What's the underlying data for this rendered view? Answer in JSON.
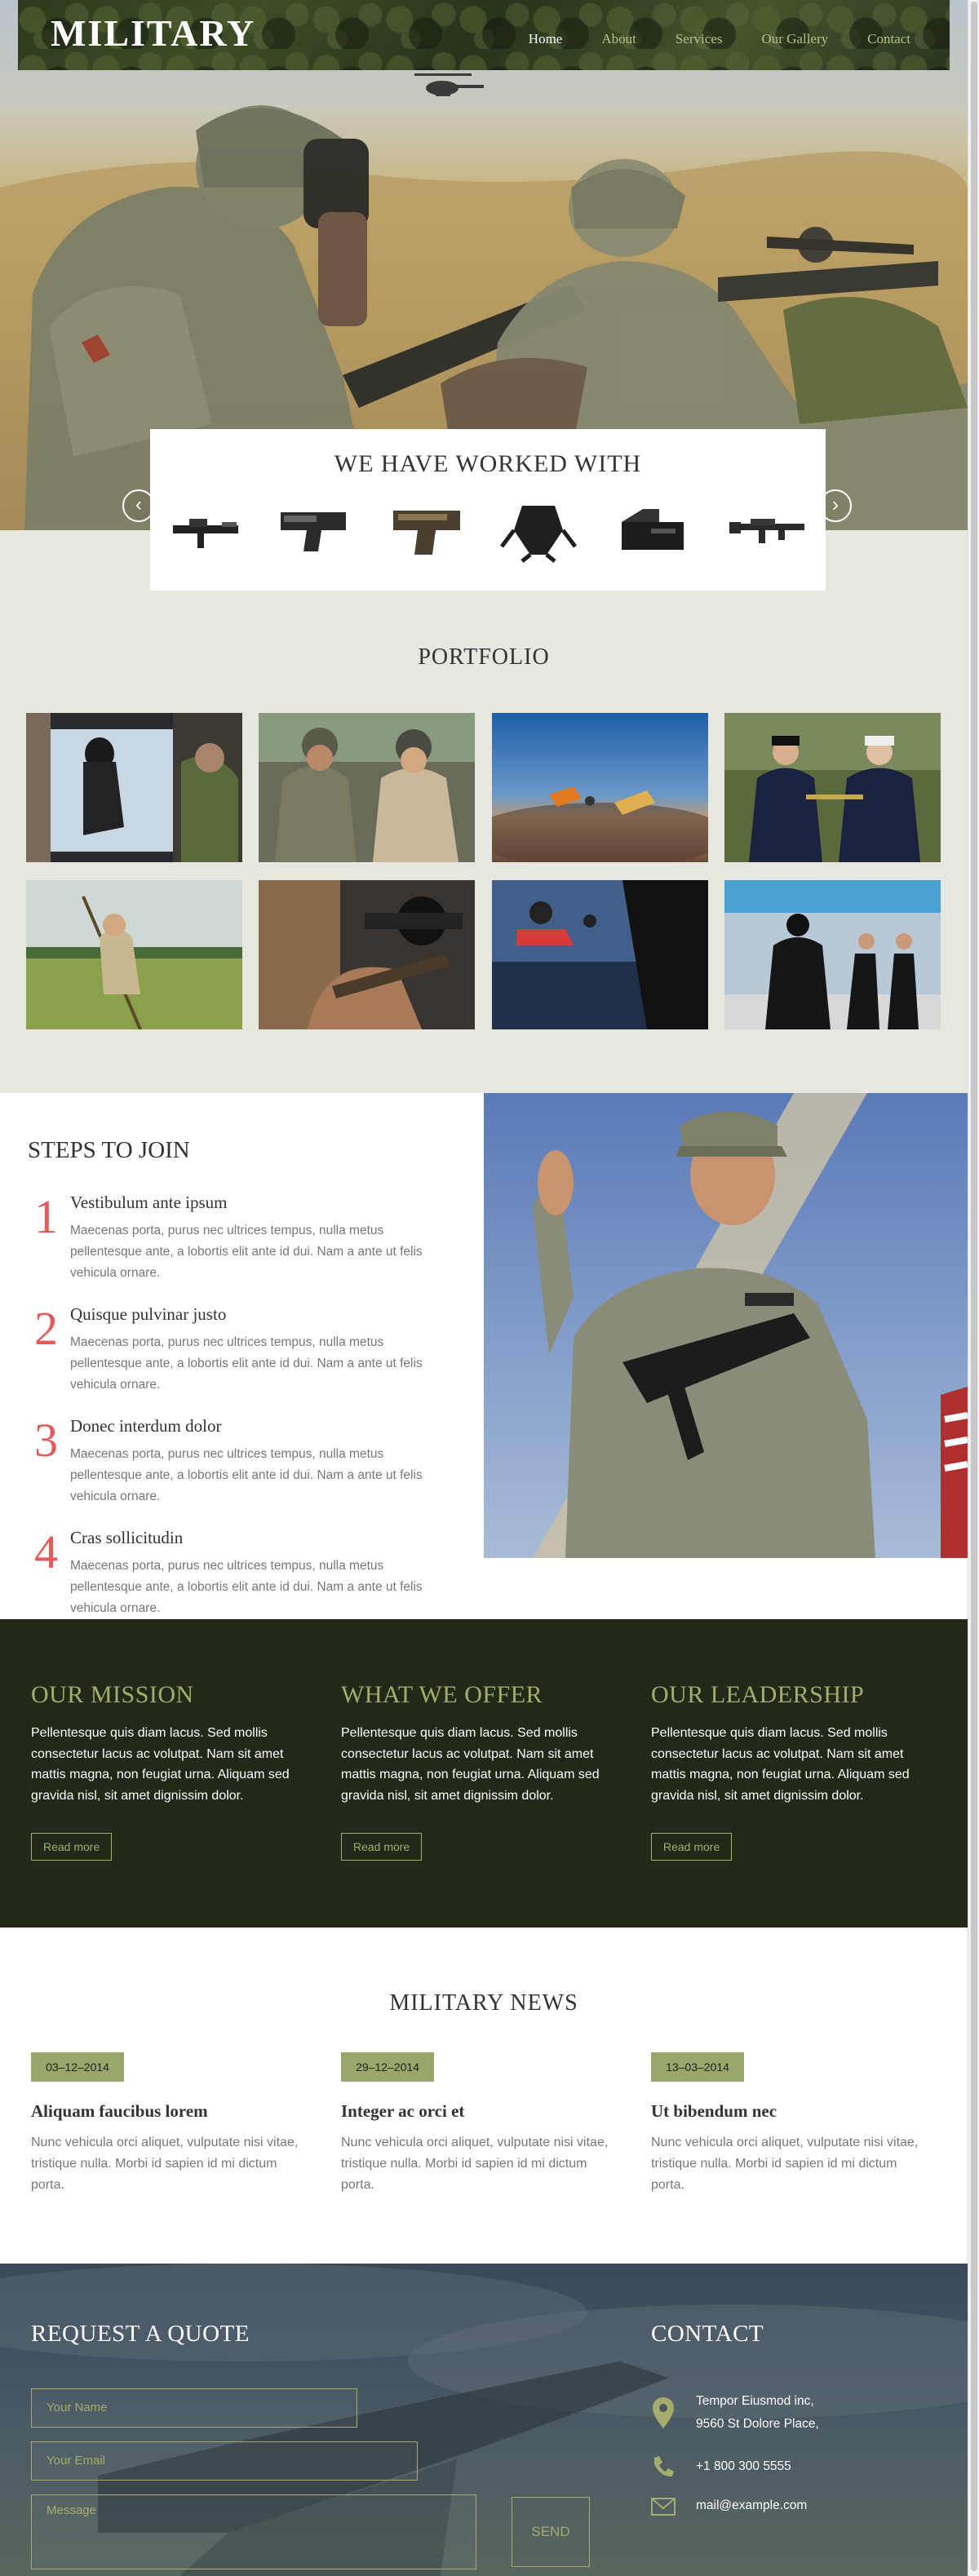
{
  "brand": {
    "logo": "MILITARY"
  },
  "nav": {
    "items": [
      "Home",
      "About",
      "Services",
      "Our Gallery",
      "Contact"
    ],
    "active_index": 0
  },
  "partners": {
    "title": "WE HAVE WORKED WITH",
    "prev_label": "‹",
    "next_label": "›"
  },
  "portfolio": {
    "title": "PORTFOLIO"
  },
  "steps": {
    "title": "STEPS TO JOIN",
    "items": [
      {
        "num": "1",
        "title": "Vestibulum ante ipsum",
        "text": "Maecenas porta, purus nec ultrices tempus, nulla metus pellentesque ante, a lobortis elit ante id dui. Nam a ante ut felis vehicula ornare."
      },
      {
        "num": "2",
        "title": "Quisque pulvinar justo",
        "text": "Maecenas porta, purus nec ultrices tempus, nulla metus pellentesque ante, a lobortis elit ante id dui. Nam a ante ut felis vehicula ornare."
      },
      {
        "num": "3",
        "title": "Donec interdum dolor",
        "text": "Maecenas porta, purus nec ultrices tempus, nulla metus pellentesque ante, a lobortis elit ante id dui. Nam a ante ut felis vehicula ornare."
      },
      {
        "num": "4",
        "title": "Cras sollicitudin",
        "text": "Maecenas porta, purus nec ultrices tempus, nulla metus pellentesque ante, a lobortis elit ante id dui. Nam a ante ut felis vehicula ornare."
      }
    ]
  },
  "mission": {
    "columns": [
      {
        "title": "OUR MISSION",
        "text": "Pellentesque quis diam lacus. Sed mollis consectetur lacus ac volutpat. Nam sit amet mattis magna, non feugiat urna. Aliquam sed gravida nisl, sit amet dignissim dolor.",
        "button": "Read more"
      },
      {
        "title": "WHAT WE OFFER",
        "text": "Pellentesque quis diam lacus. Sed mollis consectetur lacus ac volutpat. Nam sit amet mattis magna, non feugiat urna. Aliquam sed gravida nisl, sit amet dignissim dolor.",
        "button": "Read more"
      },
      {
        "title": "OUR LEADERSHIP",
        "text": "Pellentesque quis diam lacus. Sed mollis consectetur lacus ac volutpat. Nam sit amet mattis magna, non feugiat urna. Aliquam sed gravida nisl, sit amet dignissim dolor.",
        "button": "Read more"
      }
    ]
  },
  "news": {
    "title": "MILITARY NEWS",
    "items": [
      {
        "date": "03–12–2014",
        "title": "Aliquam faucibus lorem",
        "text": "Nunc vehicula orci aliquet, vulputate nisi vitae, tristique nulla. Morbi id sapien id mi dictum porta."
      },
      {
        "date": "29–12–2014",
        "title": "Integer ac orci et",
        "text": "Nunc vehicula orci aliquet, vulputate nisi vitae, tristique nulla. Morbi id sapien id mi dictum porta."
      },
      {
        "date": "13–03–2014",
        "title": "Ut bibendum nec",
        "text": "Nunc vehicula orci aliquet, vulputate nisi vitae, tristique nulla. Morbi id sapien id mi dictum porta."
      }
    ]
  },
  "quote": {
    "title": "REQUEST A QUOTE",
    "name_placeholder": "Your Name",
    "email_placeholder": "Your Email",
    "message_placeholder": "Message",
    "send": "SEND"
  },
  "contact": {
    "title": "CONTACT",
    "address_line1": "Tempor Eiusmod inc,",
    "address_line2": "9560 St Dolore Place,",
    "phone": "+1 800 300 5555",
    "email": "mail@example.com"
  },
  "colors": {
    "olive": "#a4ac6e",
    "dark_olive": "#222918",
    "step_red": "#e35a59",
    "date_badge": "#99a76a"
  }
}
